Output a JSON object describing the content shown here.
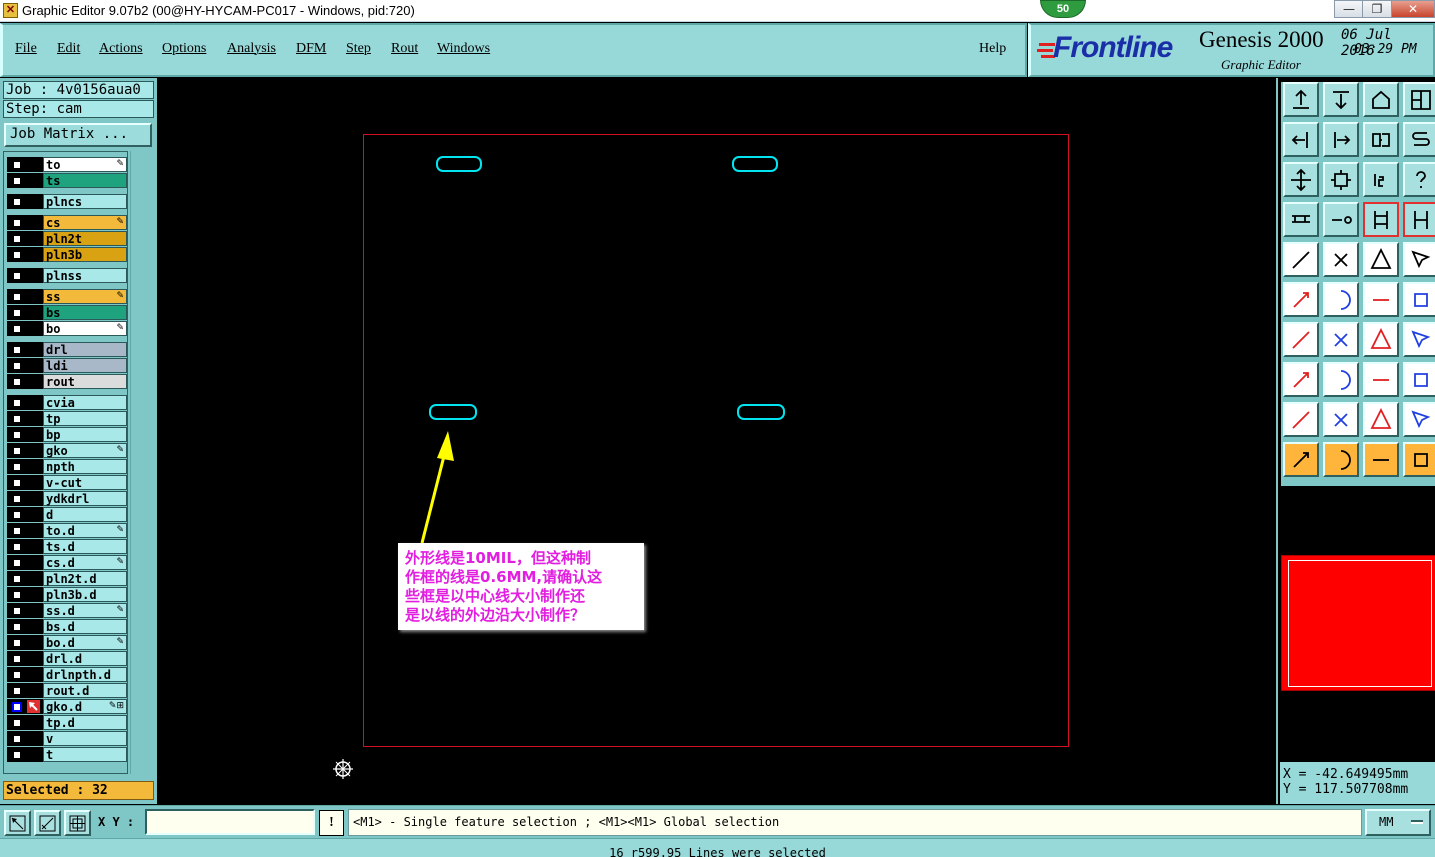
{
  "window": {
    "title": "Graphic Editor 9.07b2 (00@HY-HYCAM-PC017 - Windows, pid:720)",
    "badge": "50",
    "minimize": "—",
    "maximize": "❐",
    "close": "✕"
  },
  "menu": {
    "items": [
      "File",
      "Edit",
      "Actions",
      "Options",
      "Analysis",
      "DFM",
      "Step",
      "Rout",
      "Windows"
    ],
    "help": "Help"
  },
  "brand": {
    "logo": "Frontline",
    "product": "Genesis 2000",
    "subtitle": "Graphic Editor",
    "date": "06 Jul 2016",
    "time": "03:29 PM"
  },
  "job": {
    "job_line": "Job : 4v0156aua0",
    "step_line": "Step: cam",
    "matrix_button": "Job Matrix ..."
  },
  "layers": [
    {
      "name": "to",
      "color": "#ffffff",
      "mark": "✎"
    },
    {
      "name": "ts",
      "color": "#1fa37f",
      "mark": ""
    },
    {
      "name": "plncs",
      "color": "#a8e8e8",
      "mark": ""
    },
    {
      "name": "cs",
      "color": "#f3b93a",
      "mark": "✎"
    },
    {
      "name": "pln2t",
      "color": "#d9a212",
      "mark": ""
    },
    {
      "name": "pln3b",
      "color": "#d9a212",
      "mark": ""
    },
    {
      "name": "plnss",
      "color": "#a8e8e8",
      "mark": ""
    },
    {
      "name": "ss",
      "color": "#f3b93a",
      "mark": "✎"
    },
    {
      "name": "bs",
      "color": "#1fa37f",
      "mark": ""
    },
    {
      "name": "bo",
      "color": "#ffffff",
      "mark": "✎"
    },
    {
      "name": "drl",
      "color": "#a8b8c8",
      "mark": ""
    },
    {
      "name": "ldi",
      "color": "#a8b8c8",
      "mark": ""
    },
    {
      "name": "rout",
      "color": "#dcdcdc",
      "mark": ""
    },
    {
      "name": "cvia",
      "color": "#a8e8e8",
      "mark": ""
    },
    {
      "name": "tp",
      "color": "#a8e8e8",
      "mark": ""
    },
    {
      "name": "bp",
      "color": "#a8e8e8",
      "mark": ""
    },
    {
      "name": "gko",
      "color": "#a8e8e8",
      "mark": "✎"
    },
    {
      "name": "npth",
      "color": "#a8e8e8",
      "mark": ""
    },
    {
      "name": "v-cut",
      "color": "#a8e8e8",
      "mark": ""
    },
    {
      "name": "ydkdrl",
      "color": "#a8e8e8",
      "mark": ""
    },
    {
      "name": "d",
      "color": "#a8e8e8",
      "mark": ""
    },
    {
      "name": "to.d",
      "color": "#a8e8e8",
      "mark": "✎"
    },
    {
      "name": "ts.d",
      "color": "#a8e8e8",
      "mark": ""
    },
    {
      "name": "cs.d",
      "color": "#a8e8e8",
      "mark": "✎"
    },
    {
      "name": "pln2t.d",
      "color": "#a8e8e8",
      "mark": ""
    },
    {
      "name": "pln3b.d",
      "color": "#a8e8e8",
      "mark": ""
    },
    {
      "name": "ss.d",
      "color": "#a8e8e8",
      "mark": "✎"
    },
    {
      "name": "bs.d",
      "color": "#a8e8e8",
      "mark": ""
    },
    {
      "name": "bo.d",
      "color": "#a8e8e8",
      "mark": "✎"
    },
    {
      "name": "drl.d",
      "color": "#a8e8e8",
      "mark": ""
    },
    {
      "name": "drlnpth.d",
      "color": "#a8e8e8",
      "mark": ""
    },
    {
      "name": "rout.d",
      "color": "#a8e8e8",
      "mark": ""
    },
    {
      "name": "gko.d",
      "color": "#a8e8e8",
      "mark": "✎⊞",
      "active": true
    },
    {
      "name": "tp.d",
      "color": "#a8e8e8",
      "mark": ""
    },
    {
      "name": "v",
      "color": "#a8e8e8",
      "mark": ""
    },
    {
      "name": "t",
      "color": "#a8e8e8",
      "mark": ""
    }
  ],
  "selected_text": "Selected : 32",
  "canvas": {
    "profile_color": "#d01020",
    "slot_color": "#00e5f0",
    "arrow_color": "#ffff00",
    "note_lines": [
      "外形线是10MIL，但这种制",
      "作框的线是0.6MM,请确认这",
      "些框是以中心线大小制作还",
      "是以线的外边沿大小制作？"
    ],
    "note_color": "#e21ee0"
  },
  "coords": {
    "x": "X = -42.649495mm",
    "y": "Y = 117.507708mm"
  },
  "command": {
    "xy_label": "X Y :",
    "xy_value": "",
    "bang": "!",
    "prompt": "<M1> - Single feature selection ; <M1><M1> Global selection",
    "units": "MM"
  },
  "status_text": "16 r599.95 Lines were selected"
}
